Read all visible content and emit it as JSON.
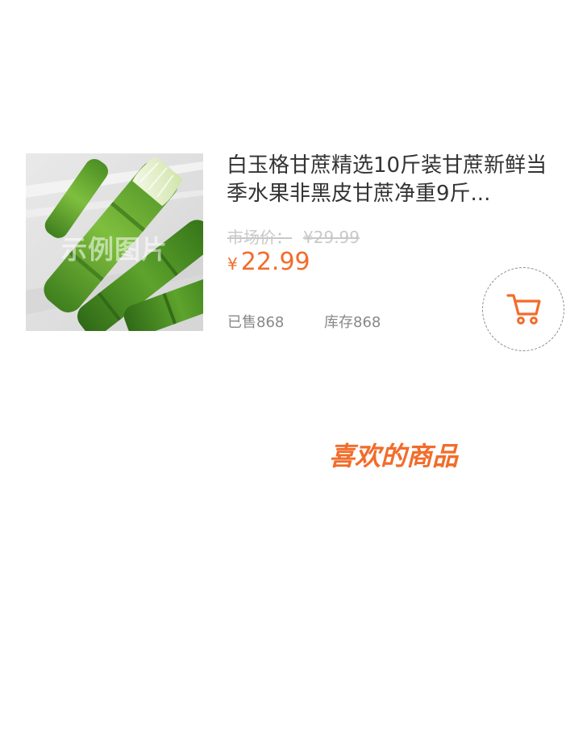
{
  "product": {
    "image_watermark": "示例图片",
    "title": "白玉格甘蔗精选10斤装甘蔗新鲜当季水果非黑皮甘蔗净重9斤...",
    "market_price_label": "市场价：",
    "market_price": "¥29.99",
    "currency_symbol": "¥",
    "price": "22.99",
    "sold": "已售868",
    "stock": "库存868",
    "cart_icon": "cart-icon"
  },
  "recommend": {
    "heading": "喜欢的商品"
  },
  "colors": {
    "accent": "#f26c2a",
    "title_text": "#333333",
    "muted_text": "#888888",
    "strike_text": "#c8c8c8"
  }
}
